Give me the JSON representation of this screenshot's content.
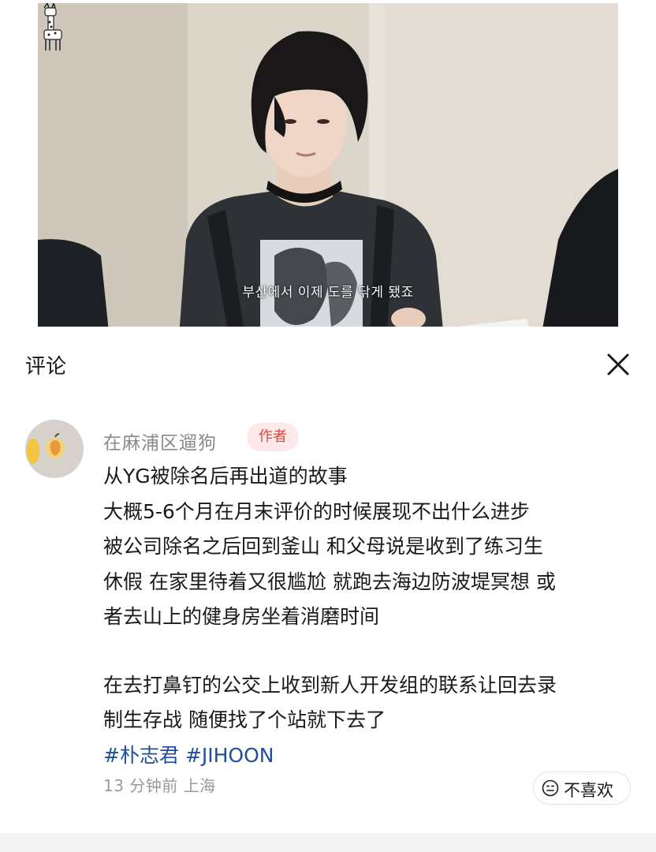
{
  "video": {
    "subtitle": "부산에서 이제 도를 닦게 됐죠"
  },
  "comments_sheet": {
    "title": "评论",
    "close_icon": "close-icon"
  },
  "comment": {
    "username": "在麻浦区遛狗",
    "badge": "作者",
    "paragraph1": [
      "从YG被除名后再出道的故事",
      "大概5-6个月在月末评价的时候展现不出什么进步",
      "被公司除名之后回到釜山 和父母说是收到了练习生",
      "休假 在家里待着又很尴尬 就跑去海边防波堤冥想 或",
      "者去山上的健身房坐着消磨时间"
    ],
    "paragraph2": [
      "在去打鼻钉的公交上收到新人开发组的联系让回去录",
      "制生存战 随便找了个站就下去了"
    ],
    "hashtags": [
      "#朴志君",
      "#JIHOON"
    ],
    "time_location": "13 分钟前 上海",
    "dislike_label": "不喜欢",
    "dislike_icon": "frown-icon"
  },
  "colors": {
    "badge_bg": "#fde9e9",
    "badge_text": "#e0453c",
    "hashtag": "#1f4f9c",
    "username": "#8a8a8a",
    "meta": "#9a9a9a"
  }
}
